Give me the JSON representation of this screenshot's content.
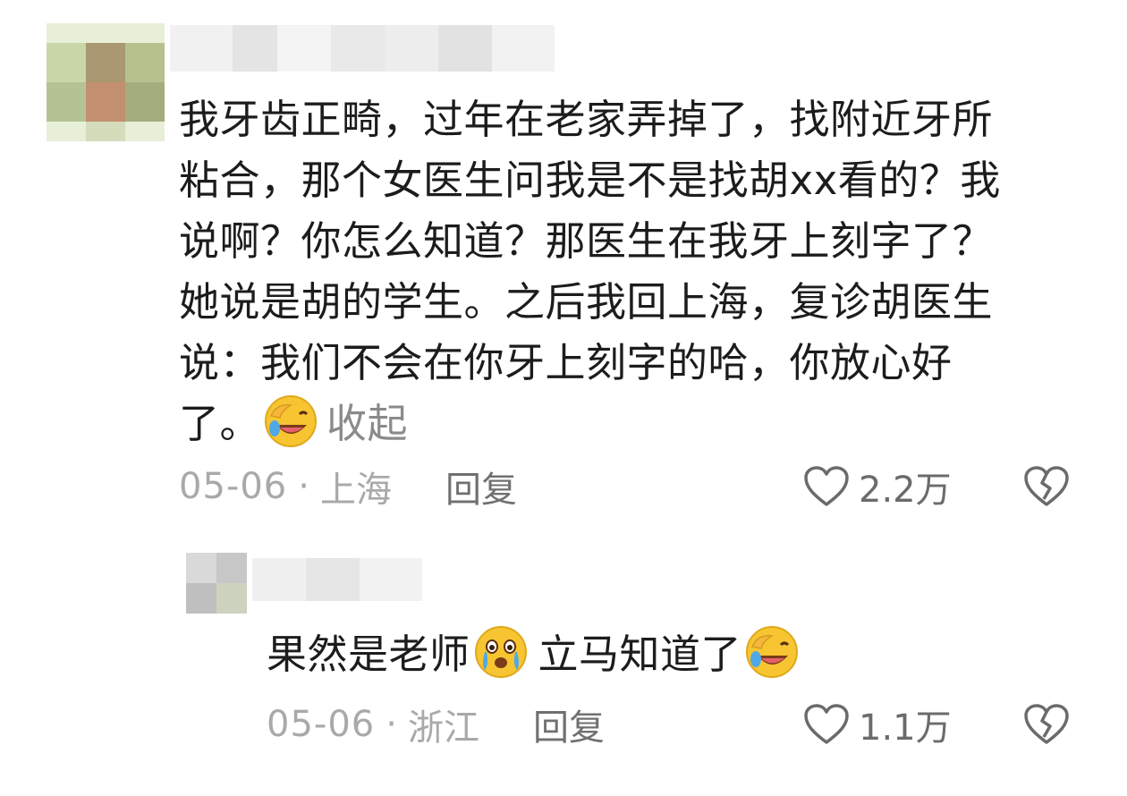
{
  "comment": {
    "lines": [
      "我牙齿正畸，过年在老家弄掉了，找附近牙所",
      "粘合，那个女医生问我是不是找胡xx看的？我",
      "说啊？你怎么知道？那医生在我牙上刻字了？",
      "她说是胡的学生。之后我回上海，复诊胡医生",
      "说：我们不会在你牙上刻字的哈，你放心好",
      "了。"
    ],
    "trailing_emoji": "facepalm-laugh-emoji",
    "collapse_label": "收起",
    "date": "05-06",
    "separator": "·",
    "location": "上海",
    "reply_label": "回复",
    "like_count": "2.2万"
  },
  "reply": {
    "text_part1": "果然是老师",
    "emoji1": "crying-face-emoji",
    "text_part2": "立马知道了",
    "emoji2": "facepalm-laugh-emoji",
    "date": "05-06",
    "separator": "·",
    "location": "浙江",
    "reply_label": "回复",
    "like_count": "1.1万"
  },
  "colors": {
    "text": "#1c1c1c",
    "meta": "#a9a9a9",
    "emoji_yellow": "#f7c531",
    "icon": "#6b6b6b"
  }
}
